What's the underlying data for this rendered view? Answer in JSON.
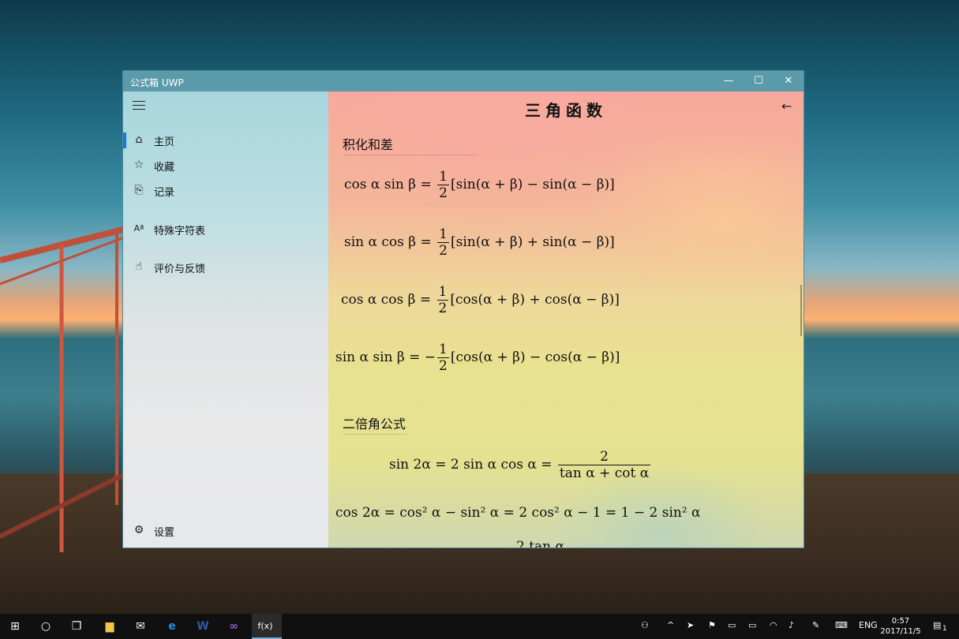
{
  "window": {
    "title": "公式箱 UWP",
    "controls": {
      "minimize": "—",
      "maximize": "☐",
      "close": "✕"
    }
  },
  "sidebar": {
    "items": [
      {
        "label": "主页",
        "icon": "home-icon",
        "active": true
      },
      {
        "label": "收藏",
        "icon": "star-icon"
      },
      {
        "label": "记录",
        "icon": "history-icon"
      },
      {
        "label": "特殊字符表",
        "icon": "special-chars-icon"
      },
      {
        "label": "评价与反馈",
        "icon": "thumbs-up-icon"
      }
    ],
    "settings_label": "设置"
  },
  "content": {
    "page_title": "三角函数",
    "sections": [
      {
        "title": "积化和差",
        "formulas": [
          {
            "lhs": "cos α sin β = ",
            "num": "1",
            "den": "2",
            "rhs": "[sin(α + β) − sin(α − β)]"
          },
          {
            "lhs": "sin α cos β = ",
            "num": "1",
            "den": "2",
            "rhs": "[sin(α + β) + sin(α − β)]"
          },
          {
            "lhs": "cos α cos β = ",
            "num": "1",
            "den": "2",
            "rhs": "[cos(α + β) + cos(α − β)]"
          },
          {
            "lhs": "sin α sin β = −",
            "num": "1",
            "den": "2",
            "rhs": "[cos(α + β) − cos(α − β)]"
          }
        ]
      },
      {
        "title": "二倍角公式",
        "formulas": [
          {
            "lhs": "sin 2α = 2 sin α cos α = ",
            "num": "2",
            "den": "tan α + cot α",
            "rhs": ""
          },
          {
            "text": "cos 2α = cos² α − sin² α = 2 cos² α − 1 = 1 − 2 sin² α"
          },
          {
            "text": "2 tan α"
          }
        ]
      }
    ]
  },
  "taskbar": {
    "tray": {
      "language": "ENG",
      "time": "0:57",
      "date": "2017/11/5",
      "notifications": "1"
    }
  },
  "colors": {
    "accent": "#1e78d6",
    "titlebar": "#5a9aaa",
    "taskbar": "#101010"
  }
}
